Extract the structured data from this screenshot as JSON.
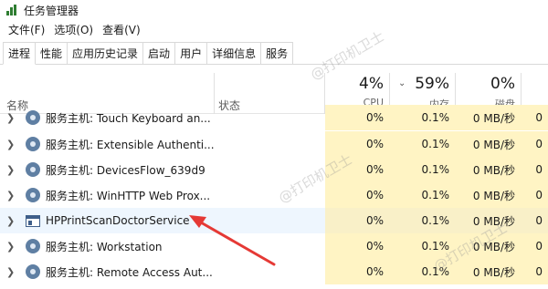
{
  "window": {
    "title": "任务管理器"
  },
  "menu": [
    "文件(F)",
    "选项(O)",
    "查看(V)"
  ],
  "tabs": [
    {
      "label": "进程",
      "active": true
    },
    {
      "label": "性能"
    },
    {
      "label": "应用历史记录"
    },
    {
      "label": "启动"
    },
    {
      "label": "用户"
    },
    {
      "label": "详细信息"
    },
    {
      "label": "服务"
    }
  ],
  "columns": {
    "name": "名称",
    "status": "状态",
    "cpu": {
      "pct": "4%",
      "label": "CPU"
    },
    "memory": {
      "pct": "59%",
      "label": "内存"
    },
    "disk": {
      "pct": "0%",
      "label": "磁盘"
    }
  },
  "rows": [
    {
      "name": "服务主机: Touch Keyboard an...",
      "icon": "gear-icon",
      "cpu": "0%",
      "memory": "0.1%",
      "disk": "0 MB/秒",
      "net": "0"
    },
    {
      "name": "服务主机: Extensible Authenti...",
      "icon": "gear-icon",
      "cpu": "0%",
      "memory": "0.1%",
      "disk": "0 MB/秒",
      "net": "0"
    },
    {
      "name": "服务主机: DevicesFlow_639d9",
      "icon": "gear-icon",
      "cpu": "0%",
      "memory": "0.1%",
      "disk": "0 MB/秒",
      "net": "0"
    },
    {
      "name": "服务主机: WinHTTP Web Prox...",
      "icon": "gear-icon",
      "cpu": "0%",
      "memory": "0.1%",
      "disk": "0 MB/秒",
      "net": "0"
    },
    {
      "name": "HPPrintScanDoctorService",
      "icon": "window-icon",
      "cpu": "0%",
      "memory": "0.1%",
      "disk": "0 MB/秒",
      "net": "0"
    },
    {
      "name": "服务主机: Workstation",
      "icon": "gear-icon",
      "cpu": "0%",
      "memory": "0.1%",
      "disk": "0 MB/秒",
      "net": "0"
    },
    {
      "name": "服务主机: Remote Access Aut...",
      "icon": "gear-icon",
      "cpu": "0%",
      "memory": "0.1%",
      "disk": "0 MB/秒",
      "net": "0"
    }
  ],
  "watermark": "@打印机卫士",
  "colors": {
    "usage_bg": "#fff4c4",
    "highlight_row": "#eef6fe",
    "arrow": "#e53935"
  }
}
